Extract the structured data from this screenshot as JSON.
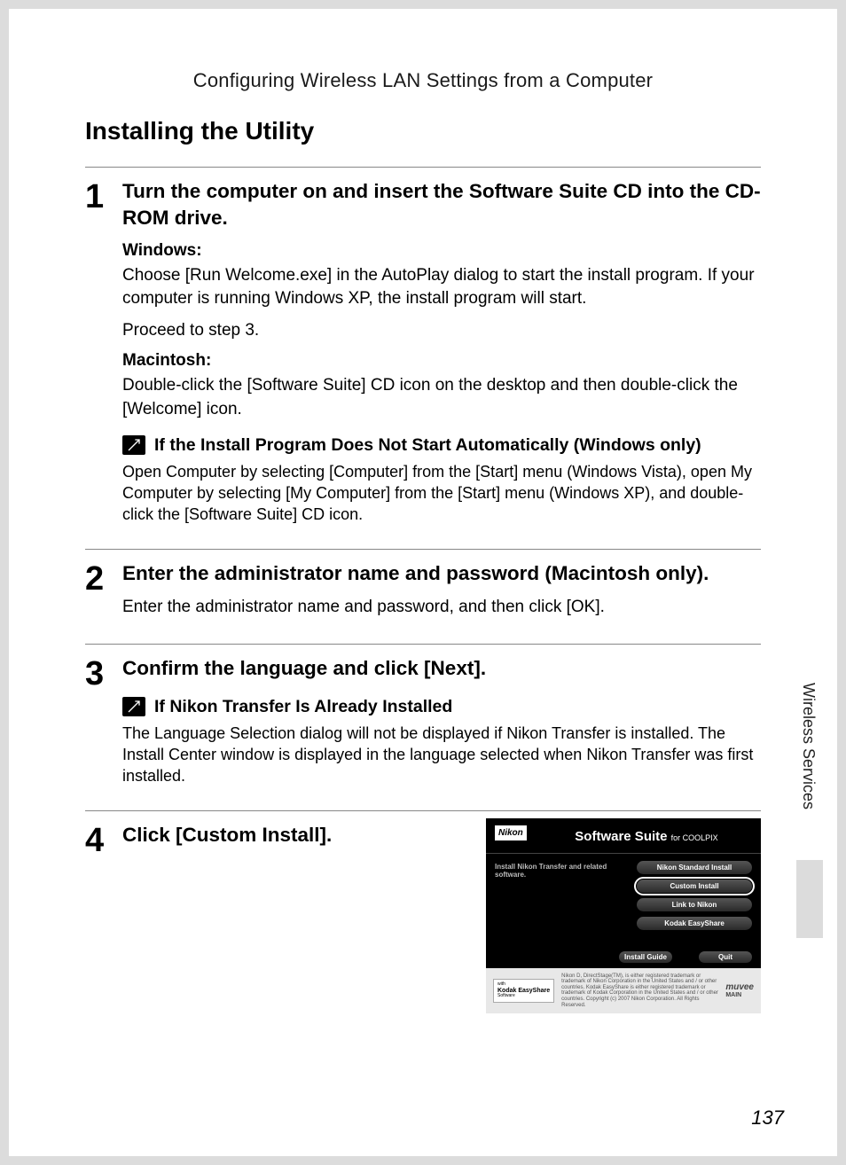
{
  "header": {
    "title": "Configuring Wireless LAN Settings from a Computer"
  },
  "section_title": "Installing the Utility",
  "side_tab": "Wireless Services",
  "page_number": "137",
  "steps": {
    "s1": {
      "num": "1",
      "title": "Turn the computer on and insert the Software Suite CD into the CD-ROM drive.",
      "win_label": "Windows:",
      "win_p1": "Choose [Run Welcome.exe] in the AutoPlay dialog to start the install program. If your computer is running Windows XP, the install program will start.",
      "win_p2": "Proceed to step 3.",
      "mac_label": "Macintosh:",
      "mac_p1": "Double-click the [Software Suite] CD icon on the desktop and then double-click the [Welcome] icon.",
      "note_title": "If the Install Program Does Not Start Automatically (Windows only)",
      "note_body": "Open Computer by selecting [Computer] from the [Start] menu (Windows Vista), open My Computer by selecting [My Computer] from the [Start] menu (Windows XP), and double-click the [Software Suite] CD icon."
    },
    "s2": {
      "num": "2",
      "title": "Enter the administrator name and password (Macintosh only).",
      "body": "Enter the administrator name and password, and then click [OK]."
    },
    "s3": {
      "num": "3",
      "title": "Confirm the language and click [Next].",
      "note_title": "If Nikon Transfer Is Already Installed",
      "note_body": "The Language Selection dialog will not be displayed if Nikon Transfer is installed. The Install Center window is displayed in the language selected when Nikon Transfer was first installed."
    },
    "s4": {
      "num": "4",
      "title": "Click [Custom Install]."
    }
  },
  "installer": {
    "logo": "Nikon",
    "title_main": "Software Suite",
    "title_sub": "for COOLPIX",
    "left_text": "Install Nikon Transfer and related software.",
    "buttons": {
      "b1": "Nikon Standard Install",
      "b2": "Custom Install",
      "b3": "Link to Nikon",
      "b4": "Kodak EasyShare"
    },
    "install_guide": "Install Guide",
    "quit": "Quit",
    "footer": {
      "kodak": "Kodak EasyShare",
      "kodak_sub": "Software",
      "text": "Nikon D, DirectStage(TM), is either registered trademark or trademark of Nikon Corporation in the United States and / or other countries. Kodak EasyShare is either registered trademark or trademark of Kodak Corporation in the United States and / or other countries. Copyright (c) 2007 Nikon Corporation. All Rights Reserved.",
      "muvee": "muvee",
      "main": "MAIN"
    }
  }
}
